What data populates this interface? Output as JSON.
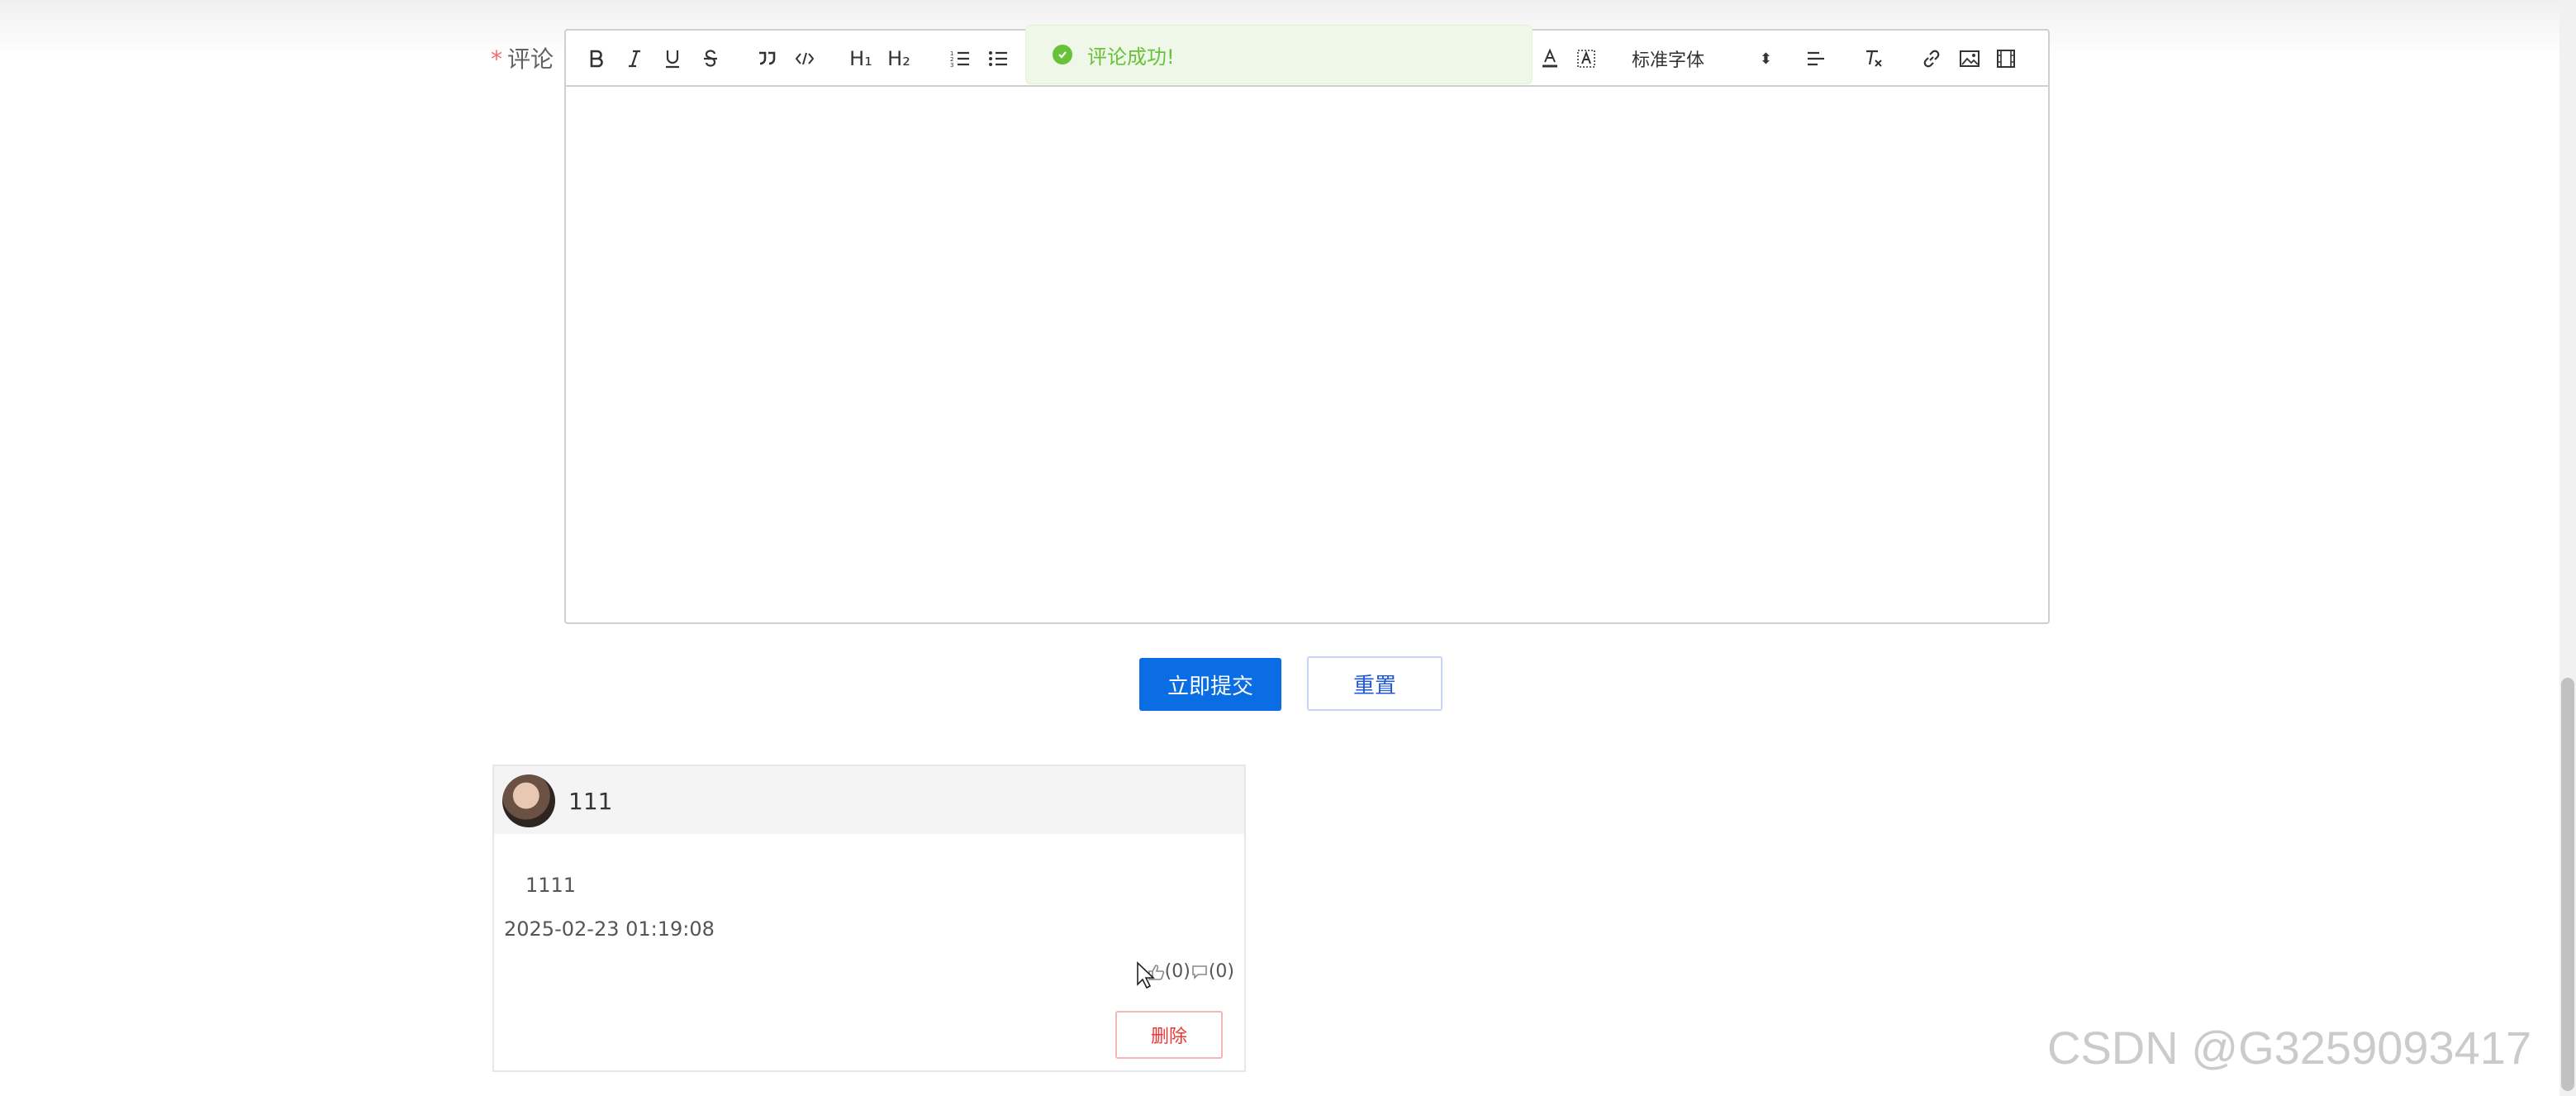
{
  "form": {
    "required_mark": "*",
    "comment_label": "评论"
  },
  "toolbar": {
    "heading1": "H₁",
    "heading2": "H₂",
    "font_select": "标准字体",
    "font_select_arrow": "⬍"
  },
  "toast": {
    "message": "评论成功!"
  },
  "buttons": {
    "submit": "立即提交",
    "reset": "重置"
  },
  "comment": {
    "username": "111",
    "content": "1111",
    "timestamp": "2025-02-23 01:19:08",
    "like_count": "(0)",
    "reply_count": "(0)",
    "delete_label": "删除"
  },
  "watermark": "CSDN @G3259093417",
  "colors": {
    "primary": "#0a6de3",
    "success": "#67c23a",
    "danger": "#e33333"
  }
}
